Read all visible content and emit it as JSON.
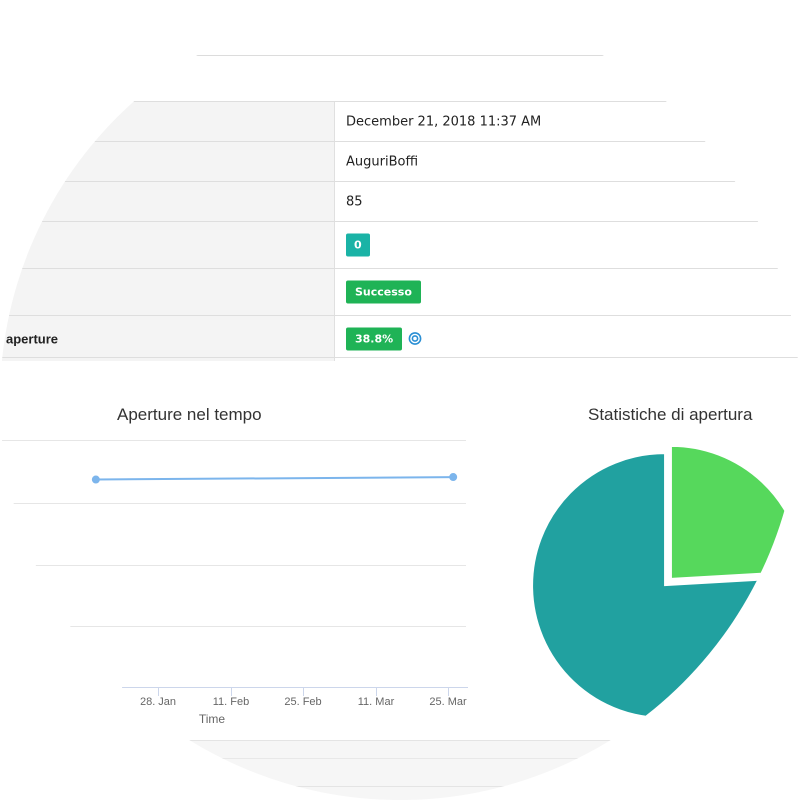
{
  "table": {
    "rows": [
      {
        "label": "",
        "value": "December 21, 2018 11:37 AM",
        "type": "text"
      },
      {
        "label": "",
        "value": "AuguriBoffi",
        "type": "text"
      },
      {
        "label": "",
        "value": "85",
        "type": "text"
      },
      {
        "label": "",
        "value": "0",
        "type": "badge",
        "color": "#1ab3a6"
      },
      {
        "label": "",
        "value": "Successo",
        "type": "badge",
        "color": "#1fb356"
      },
      {
        "label": "aperture",
        "value": "38.8%",
        "type": "badge",
        "color": "#1fb356",
        "icon": "target-icon"
      }
    ]
  },
  "chart_data": [
    {
      "type": "line",
      "title": "Aperture nel tempo",
      "xlabel": "Time",
      "ylabel": "",
      "x_ticks": [
        "28. Jan",
        "11. Feb",
        "25. Feb",
        "11. Mar",
        "25. Mar"
      ],
      "series": [
        {
          "color": "#7cb5ec",
          "x": [
            "2019-01-16",
            "2019-03-26"
          ],
          "y": [
            84,
            85
          ]
        }
      ],
      "ylim": [
        0,
        100
      ],
      "grid": true
    },
    {
      "type": "pie",
      "title": "Statistiche di apertura",
      "series": [
        {
          "values": [
            20,
            63
          ],
          "colors": [
            "#56d85c",
            "#21a1a0"
          ]
        }
      ]
    }
  ]
}
